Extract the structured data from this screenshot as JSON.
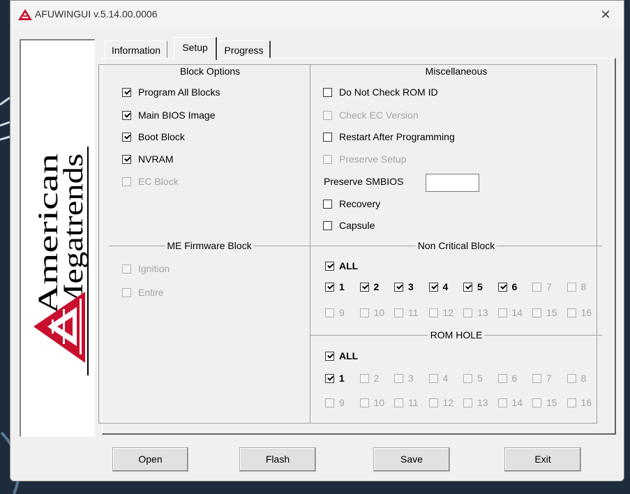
{
  "window": {
    "title": "AFUWINGUI v.5.14.00.0006",
    "close_glyph": "✕"
  },
  "logo": {
    "line1": "American",
    "line2": "Megatrends",
    "brand_red": "#c8102e"
  },
  "tabs": [
    {
      "label": "Information",
      "active": false
    },
    {
      "label": "Setup",
      "active": true
    },
    {
      "label": "Progress",
      "active": false
    }
  ],
  "groups": {
    "block_options": {
      "title": "Block Options",
      "items": [
        {
          "label": "Program All Blocks",
          "checked": true,
          "enabled": true
        },
        {
          "label": "Main BIOS Image",
          "checked": true,
          "enabled": true
        },
        {
          "label": "Boot Block",
          "checked": true,
          "enabled": true
        },
        {
          "label": "NVRAM",
          "checked": true,
          "enabled": true
        },
        {
          "label": "EC Block",
          "checked": false,
          "enabled": false
        }
      ]
    },
    "miscellaneous": {
      "title": "Miscellaneous",
      "items": [
        {
          "label": "Do Not Check ROM ID",
          "checked": false,
          "enabled": true
        },
        {
          "label": "Check EC Version",
          "checked": false,
          "enabled": false
        },
        {
          "label": "Restart After Programming",
          "checked": false,
          "enabled": true
        },
        {
          "label": "Preserve Setup",
          "checked": false,
          "enabled": false
        }
      ],
      "preserve_smbios_label": "Preserve SMBIOS",
      "preserve_smbios_value": "",
      "items2": [
        {
          "label": "Recovery",
          "checked": false,
          "enabled": true
        },
        {
          "label": "Capsule",
          "checked": false,
          "enabled": true
        }
      ]
    },
    "me_firmware": {
      "title": "ME Firmware Block",
      "items": [
        {
          "label": "Ignition",
          "checked": false,
          "enabled": false
        },
        {
          "label": "Entire",
          "checked": false,
          "enabled": false
        }
      ]
    },
    "non_critical": {
      "title": "Non Critical Block",
      "all": {
        "label": "ALL",
        "checked": true,
        "enabled": true
      },
      "blocks": [
        {
          "label": "1",
          "checked": true,
          "enabled": true
        },
        {
          "label": "2",
          "checked": true,
          "enabled": true
        },
        {
          "label": "3",
          "checked": true,
          "enabled": true
        },
        {
          "label": "4",
          "checked": true,
          "enabled": true
        },
        {
          "label": "5",
          "checked": true,
          "enabled": true
        },
        {
          "label": "6",
          "checked": true,
          "enabled": true
        },
        {
          "label": "7",
          "checked": false,
          "enabled": false
        },
        {
          "label": "8",
          "checked": false,
          "enabled": false
        },
        {
          "label": "9",
          "checked": false,
          "enabled": false
        },
        {
          "label": "10",
          "checked": false,
          "enabled": false
        },
        {
          "label": "11",
          "checked": false,
          "enabled": false
        },
        {
          "label": "12",
          "checked": false,
          "enabled": false
        },
        {
          "label": "13",
          "checked": false,
          "enabled": false
        },
        {
          "label": "14",
          "checked": false,
          "enabled": false
        },
        {
          "label": "15",
          "checked": false,
          "enabled": false
        },
        {
          "label": "16",
          "checked": false,
          "enabled": false
        }
      ]
    },
    "rom_hole": {
      "title": "ROM HOLE",
      "all": {
        "label": "ALL",
        "checked": true,
        "enabled": true
      },
      "blocks": [
        {
          "label": "1",
          "checked": true,
          "enabled": true
        },
        {
          "label": "2",
          "checked": false,
          "enabled": false
        },
        {
          "label": "3",
          "checked": false,
          "enabled": false
        },
        {
          "label": "4",
          "checked": false,
          "enabled": false
        },
        {
          "label": "5",
          "checked": false,
          "enabled": false
        },
        {
          "label": "6",
          "checked": false,
          "enabled": false
        },
        {
          "label": "7",
          "checked": false,
          "enabled": false
        },
        {
          "label": "8",
          "checked": false,
          "enabled": false
        },
        {
          "label": "9",
          "checked": false,
          "enabled": false
        },
        {
          "label": "10",
          "checked": false,
          "enabled": false
        },
        {
          "label": "11",
          "checked": false,
          "enabled": false
        },
        {
          "label": "12",
          "checked": false,
          "enabled": false
        },
        {
          "label": "13",
          "checked": false,
          "enabled": false
        },
        {
          "label": "14",
          "checked": false,
          "enabled": false
        },
        {
          "label": "15",
          "checked": false,
          "enabled": false
        },
        {
          "label": "16",
          "checked": false,
          "enabled": false
        }
      ]
    }
  },
  "buttons": {
    "open": "Open",
    "flash": "Flash",
    "save": "Save",
    "exit": "Exit"
  }
}
